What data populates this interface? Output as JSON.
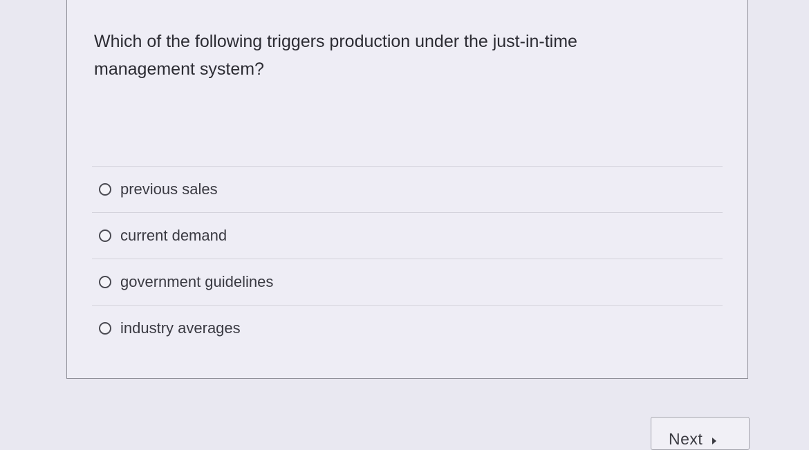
{
  "question": {
    "text": "Which of the following triggers production under the just-in-time management system?"
  },
  "options": [
    {
      "label": "previous sales",
      "selected": false
    },
    {
      "label": "current demand",
      "selected": false
    },
    {
      "label": "government guidelines",
      "selected": false
    },
    {
      "label": "industry averages",
      "selected": false
    }
  ],
  "navigation": {
    "next_label": "Next",
    "next_icon": "play-arrow-icon"
  }
}
